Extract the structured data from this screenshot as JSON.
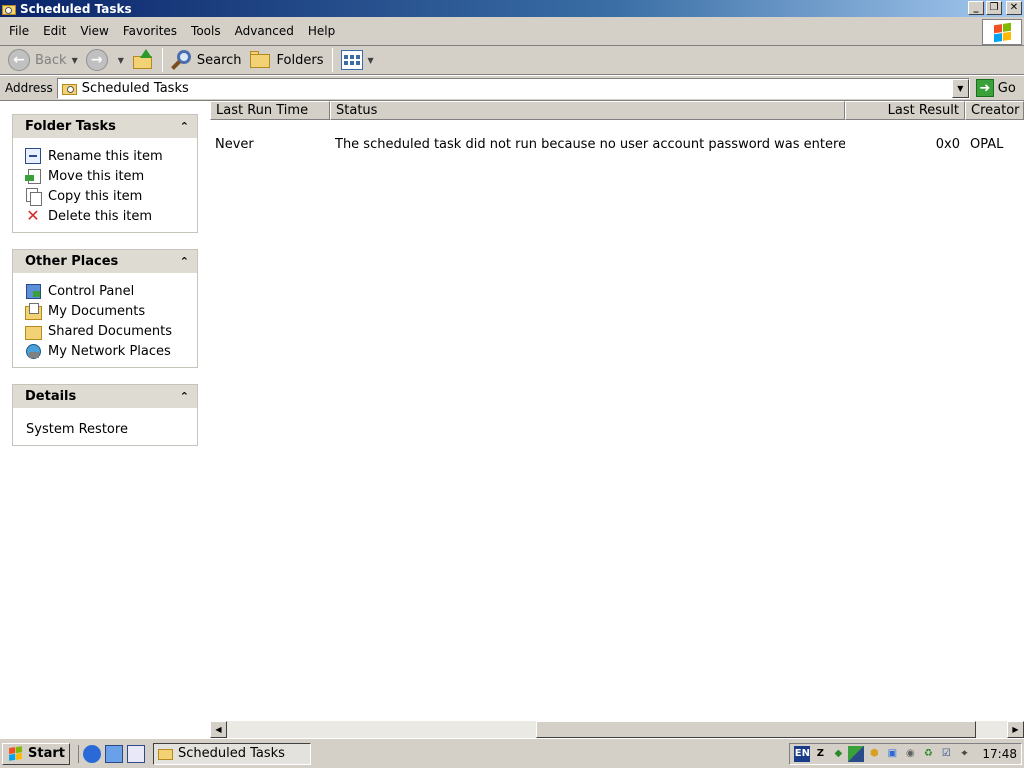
{
  "window": {
    "title": "Scheduled Tasks",
    "controls": {
      "minimize": "_",
      "restore": "❐",
      "close": "✕"
    }
  },
  "menu": [
    {
      "label": "File"
    },
    {
      "label": "Edit"
    },
    {
      "label": "View"
    },
    {
      "label": "Favorites"
    },
    {
      "label": "Tools"
    },
    {
      "label": "Advanced"
    },
    {
      "label": "Help"
    }
  ],
  "toolbar": {
    "back_label": "Back",
    "search_label": "Search",
    "folders_label": "Folders"
  },
  "address": {
    "label": "Address",
    "value": "Scheduled Tasks",
    "go_label": "Go"
  },
  "panels": {
    "folder_tasks": {
      "title": "Folder Tasks",
      "items": [
        "Rename this item",
        "Move this item",
        "Copy this item",
        "Delete this item"
      ]
    },
    "other_places": {
      "title": "Other Places",
      "items": [
        "Control Panel",
        "My Documents",
        "Shared Documents",
        "My Network Places"
      ]
    },
    "details": {
      "title": "Details",
      "text": "System Restore"
    }
  },
  "list": {
    "columns": [
      "Last Run Time",
      "Status",
      "Last Result",
      "Creator"
    ],
    "rows": [
      {
        "last_run": "Never",
        "status": "The scheduled task did not run because no user account password was entered.",
        "last_result": "0x0",
        "creator": "OPAL"
      }
    ]
  },
  "taskbar": {
    "start_label": "Start",
    "task_label": "Scheduled Tasks",
    "tray_lang": "EN",
    "clock": "17:48"
  },
  "colors": {
    "title_active": "#0a246a",
    "panel_header": "#dedbd3",
    "chrome": "#d4d0c8"
  }
}
